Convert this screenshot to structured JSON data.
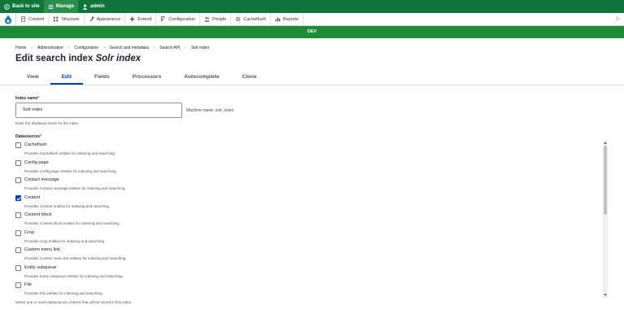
{
  "toolbar": {
    "back_label": "Back to site",
    "manage_label": "Manage",
    "user_label": "admin"
  },
  "tray": {
    "items": [
      {
        "label": "Content",
        "icon": "content-icon"
      },
      {
        "label": "Structure",
        "icon": "structure-icon"
      },
      {
        "label": "Appearance",
        "icon": "appearance-icon"
      },
      {
        "label": "Extend",
        "icon": "extend-icon"
      },
      {
        "label": "Configuration",
        "icon": "wrench-icon"
      },
      {
        "label": "People",
        "icon": "people-icon"
      },
      {
        "label": "Cacheflush",
        "icon": "gear-icon"
      },
      {
        "label": "Reports",
        "icon": "reports-icon"
      }
    ]
  },
  "environment": {
    "label": "DEV",
    "color": "#1e8c36"
  },
  "breadcrumb": [
    "Home",
    "Administration",
    "Configuration",
    "Search and metadata",
    "Search API",
    "Solr index"
  ],
  "page": {
    "title_prefix": "Edit search index ",
    "title_name": "Solr index"
  },
  "tabs": [
    {
      "label": "View",
      "active": false
    },
    {
      "label": "Edit",
      "active": true
    },
    {
      "label": "Fields",
      "active": false
    },
    {
      "label": "Processors",
      "active": false
    },
    {
      "label": "Autocomplete",
      "active": false
    },
    {
      "label": "Clone",
      "active": false
    }
  ],
  "form": {
    "index_name": {
      "label": "Index name",
      "required_mark": "*",
      "value": "Solr index",
      "machine_name": "Machine name: solr_index",
      "description": "Enter the displayed name for the index."
    },
    "datasources": {
      "label": "Datasources",
      "required_mark": "*",
      "description": "Select one or more datasources of items that will be stored in this index.",
      "items": [
        {
          "label": "Cacheflush",
          "desc": "Provides Cacheflush entities for indexing and searching.",
          "checked": false
        },
        {
          "label": "Config page",
          "desc": "Provides Config page entities for indexing and searching.",
          "checked": false
        },
        {
          "label": "Contact message",
          "desc": "Provides Contact message entities for indexing and searching.",
          "checked": false
        },
        {
          "label": "Content",
          "desc": "Provides Content entities for indexing and searching.",
          "checked": true
        },
        {
          "label": "Content block",
          "desc": "Provides Content block entities for indexing and searching.",
          "checked": false
        },
        {
          "label": "Crop",
          "desc": "Provides Crop entities for indexing and searching.",
          "checked": false
        },
        {
          "label": "Custom menu link",
          "desc": "Provides Custom menu link entities for indexing and searching.",
          "checked": false
        },
        {
          "label": "Entity subqueue",
          "desc": "Provides Entity subqueue entities for indexing and searching.",
          "checked": false
        },
        {
          "label": "File",
          "desc": "Provides File entities for indexing and searching.",
          "checked": false
        }
      ]
    }
  },
  "colors": {
    "toolbar": "#0f7539",
    "accent": "#003ecc"
  }
}
